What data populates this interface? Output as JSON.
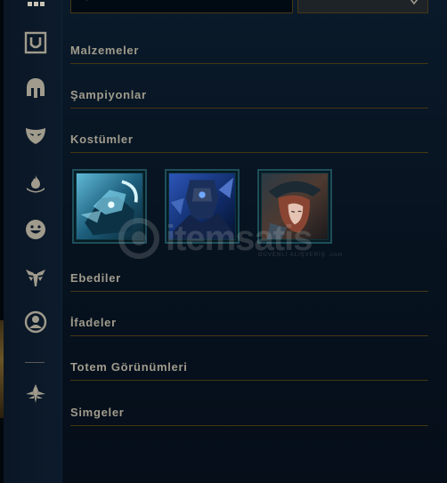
{
  "search": {
    "placeholder": "",
    "value": ""
  },
  "sort": {
    "selected": ""
  },
  "sidebar": {
    "items": [
      {
        "name": "all-items",
        "icon": "grid-icon"
      },
      {
        "name": "items",
        "icon": "shield-frame-icon"
      },
      {
        "name": "champions",
        "icon": "helmet-icon"
      },
      {
        "name": "skins",
        "icon": "mask-icon"
      },
      {
        "name": "ward-skins",
        "icon": "flame-icon"
      },
      {
        "name": "emotes",
        "icon": "smiley-icon"
      },
      {
        "name": "eternals",
        "icon": "wing-icon"
      },
      {
        "name": "icons",
        "icon": "profile-icon"
      },
      {
        "name": "totems",
        "icon": "crest-icon"
      }
    ]
  },
  "sections": {
    "malzemeler": "Malzemeler",
    "sampiyonlar": "Şampiyonlar",
    "kostumler": "Kostümler",
    "ebediler": "Ebediler",
    "ifadeler": "İfadeler",
    "totem": "Totem Görünümleri",
    "simgeler": "Simgeler"
  },
  "skins": [
    {
      "name": "skin-tile-1",
      "accent": "#3c8fb0"
    },
    {
      "name": "skin-tile-2",
      "accent": "#2b4f9c"
    },
    {
      "name": "skin-tile-3",
      "accent": "#6a4a3a"
    }
  ],
  "watermark": {
    "text": "itemsatis",
    "sub": "GÜVENLİ ALIŞVERİŞ .com"
  },
  "colors": {
    "gold_rule": "#463714",
    "text_muted": "#a09b8c",
    "tile_border": "#1e4e5a"
  }
}
